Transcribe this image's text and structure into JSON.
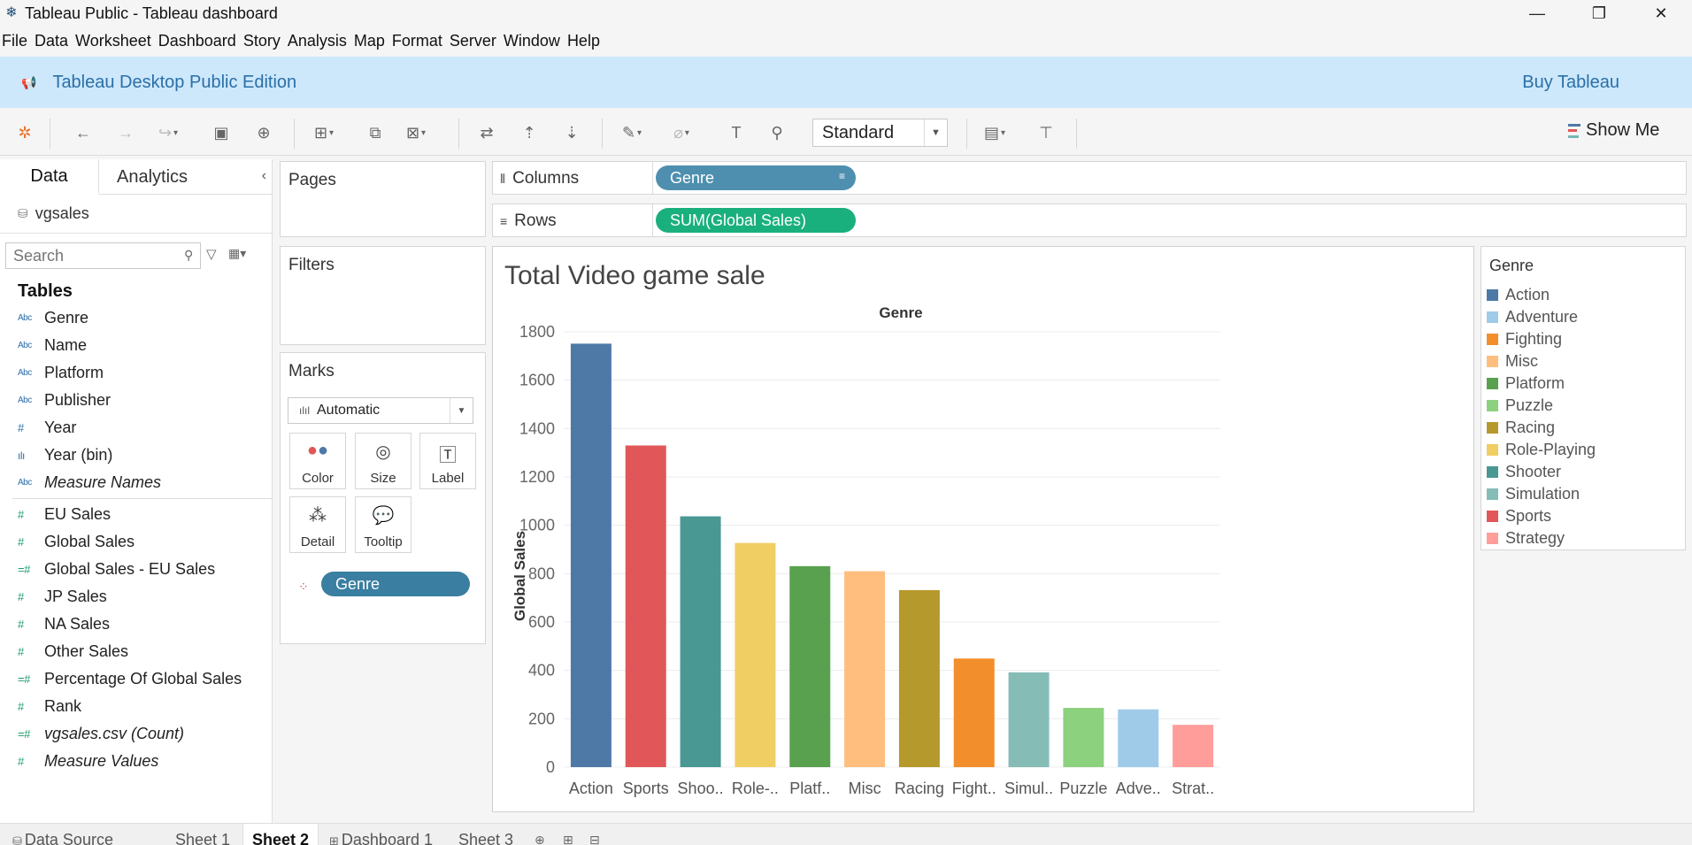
{
  "window": {
    "title": "Tableau Public - Tableau dashboard",
    "minimize_glyph": "—",
    "restore_glyph": "❐",
    "close_glyph": "✕"
  },
  "menu": [
    "File",
    "Data",
    "Worksheet",
    "Dashboard",
    "Story",
    "Analysis",
    "Map",
    "Format",
    "Server",
    "Window",
    "Help"
  ],
  "banner": {
    "edition": "Tableau Desktop Public Edition",
    "buy": "Buy Tableau"
  },
  "toolbar": {
    "fit": "Standard",
    "show_me": "Show Me"
  },
  "datapane": {
    "tab_data": "Data",
    "tab_analytics": "Analytics",
    "datasource": "vgsales",
    "search_placeholder": "Search",
    "tables_heading": "Tables",
    "dimensions": [
      {
        "type": "Abc",
        "name": "Genre"
      },
      {
        "type": "Abc",
        "name": "Name"
      },
      {
        "type": "Abc",
        "name": "Platform"
      },
      {
        "type": "Abc",
        "name": "Publisher"
      },
      {
        "type": "#",
        "name": "Year"
      },
      {
        "type": "bin",
        "name": "Year (bin)"
      },
      {
        "type": "Abc",
        "name": "Measure Names",
        "italic": true
      }
    ],
    "measures": [
      {
        "type": "#",
        "name": "EU Sales"
      },
      {
        "type": "#",
        "name": "Global Sales"
      },
      {
        "type": "=#",
        "name": "Global Sales - EU Sales"
      },
      {
        "type": "#",
        "name": "JP Sales"
      },
      {
        "type": "#",
        "name": "NA Sales"
      },
      {
        "type": "#",
        "name": "Other Sales"
      },
      {
        "type": "=#",
        "name": "Percentage  Of Global Sales"
      },
      {
        "type": "#",
        "name": "Rank"
      },
      {
        "type": "=#",
        "name": "vgsales.csv (Count)",
        "italic": true
      },
      {
        "type": "#",
        "name": "Measure Values",
        "italic": true
      }
    ]
  },
  "cards": {
    "pages": "Pages",
    "filters": "Filters",
    "marks": "Marks",
    "mark_type": "Automatic",
    "buttons": {
      "color": "Color",
      "size": "Size",
      "label": "Label",
      "detail": "Detail",
      "tooltip": "Tooltip"
    },
    "color_pill": "Genre"
  },
  "shelves": {
    "columns_label": "Columns",
    "columns_pill": "Genre",
    "rows_label": "Rows",
    "rows_pill": "SUM(Global Sales)"
  },
  "view": {
    "title": "Total Video game sale"
  },
  "legend": {
    "title": "Genre",
    "items": [
      {
        "name": "Action",
        "color": "#4e79a7"
      },
      {
        "name": "Adventure",
        "color": "#a0cbe8"
      },
      {
        "name": "Fighting",
        "color": "#f28e2b"
      },
      {
        "name": "Misc",
        "color": "#ffbe7d"
      },
      {
        "name": "Platform",
        "color": "#59a14f"
      },
      {
        "name": "Puzzle",
        "color": "#8cd17d"
      },
      {
        "name": "Racing",
        "color": "#b6992d"
      },
      {
        "name": "Role-Playing",
        "color": "#f1ce63"
      },
      {
        "name": "Shooter",
        "color": "#499894"
      },
      {
        "name": "Simulation",
        "color": "#86bcb6"
      },
      {
        "name": "Sports",
        "color": "#e15759"
      },
      {
        "name": "Strategy",
        "color": "#ff9d9a"
      }
    ]
  },
  "chart_data": {
    "type": "bar",
    "title": "Total Video game sale",
    "top_header": "Genre",
    "xlabel": "",
    "ylabel": "Global Sales",
    "ylim": [
      0,
      1800
    ],
    "yticks": [
      0,
      200,
      400,
      600,
      800,
      1000,
      1200,
      1400,
      1600,
      1800
    ],
    "grid": true,
    "categories": [
      "Action",
      "Sports",
      "Shoo..",
      "Role-..",
      "Platf..",
      "Misc",
      "Racing",
      "Fight..",
      "Simul..",
      "Puzzle",
      "Adve..",
      "Strat.."
    ],
    "values": [
      1751,
      1330,
      1037,
      927,
      831,
      810,
      732,
      449,
      392,
      245,
      239,
      175
    ],
    "colors": [
      "#4e79a7",
      "#e15759",
      "#499894",
      "#f1ce63",
      "#59a14f",
      "#ffbe7d",
      "#b6992d",
      "#f28e2b",
      "#86bcb6",
      "#8cd17d",
      "#a0cbe8",
      "#ff9d9a"
    ]
  },
  "sheets": {
    "data_source": "Data Source",
    "tabs": [
      "Sheet 1",
      "Sheet 2",
      "Dashboard 1",
      "Sheet 3"
    ],
    "active": "Sheet 2"
  }
}
